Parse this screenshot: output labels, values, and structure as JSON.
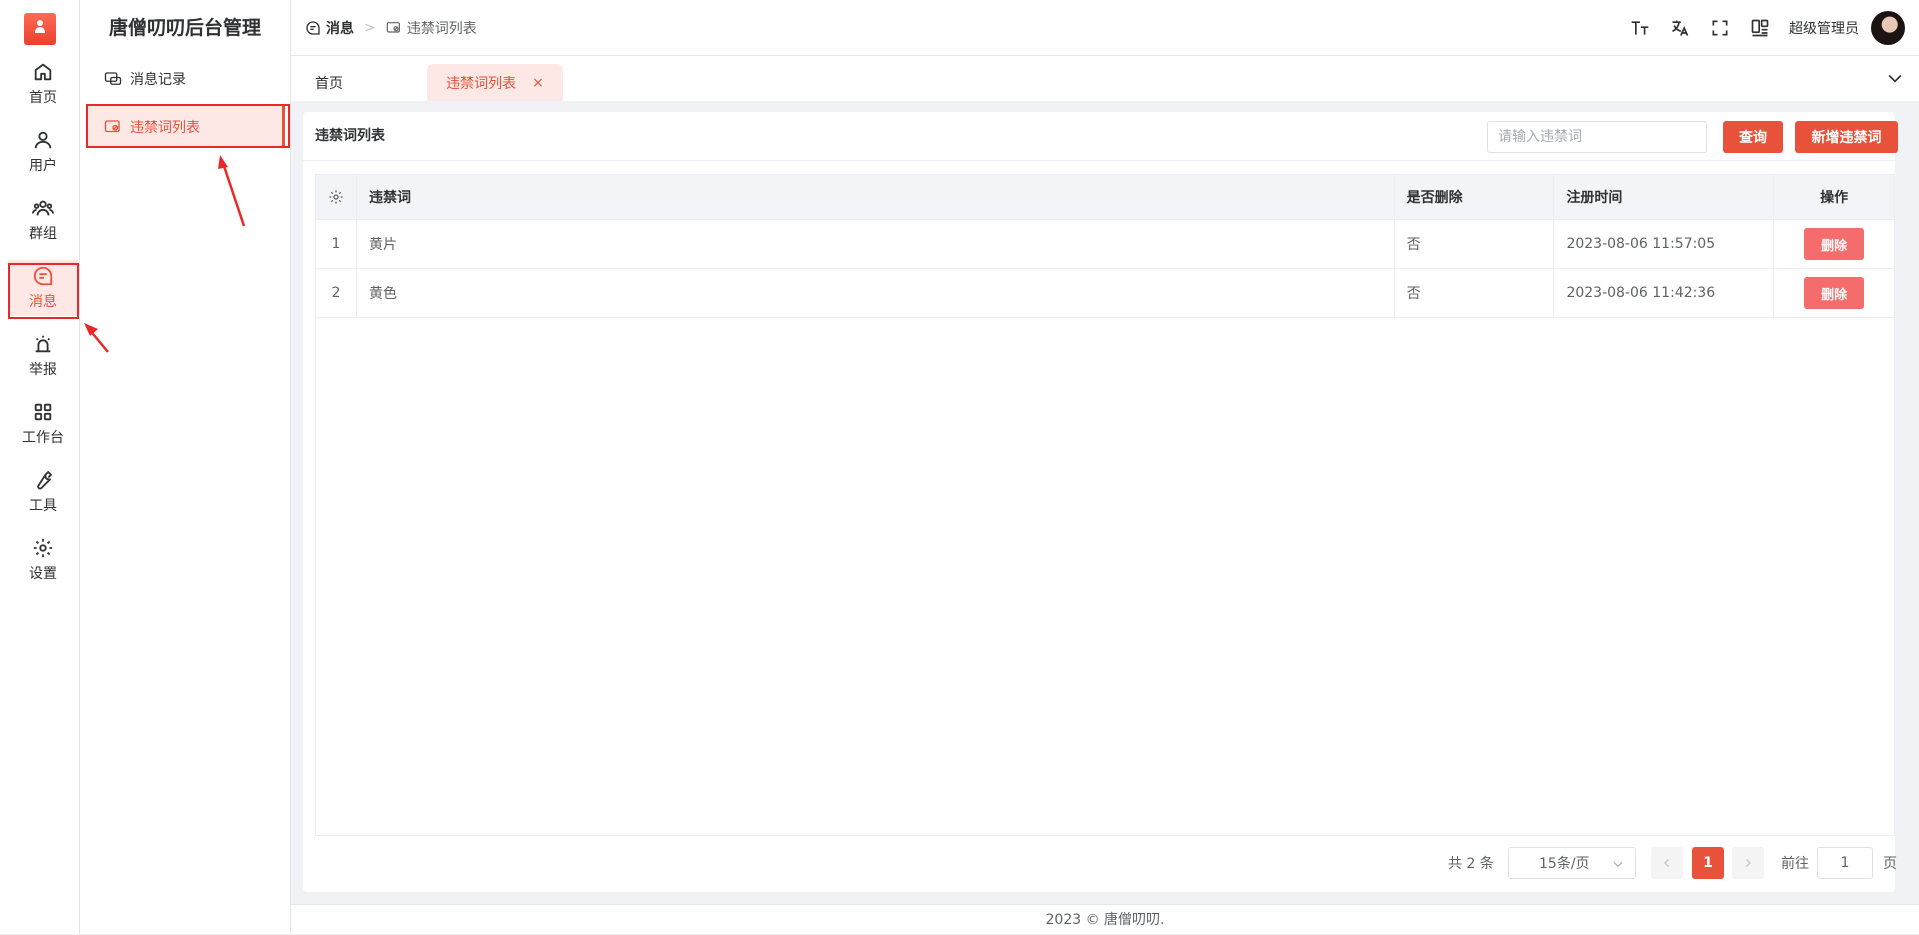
{
  "sidebar": {
    "items": [
      {
        "label": "首页",
        "icon": "home-icon"
      },
      {
        "label": "用户",
        "icon": "user-icon"
      },
      {
        "label": "群组",
        "icon": "group-icon"
      },
      {
        "label": "消息",
        "icon": "message-icon"
      },
      {
        "label": "举报",
        "icon": "alarm-icon"
      },
      {
        "label": "工作台",
        "icon": "grid-icon"
      },
      {
        "label": "工具",
        "icon": "wrench-icon"
      },
      {
        "label": "设置",
        "icon": "gear-icon"
      }
    ],
    "active_index": 3
  },
  "submenu": {
    "title": "唐僧叨叨后台管理",
    "items": [
      {
        "label": "消息记录",
        "icon": "chat-record-icon"
      },
      {
        "label": "违禁词列表",
        "icon": "forbidden-word-icon"
      }
    ],
    "active_index": 1
  },
  "header": {
    "breadcrumb": [
      "消息",
      "违禁词列表"
    ],
    "username": "超级管理员"
  },
  "tabs": {
    "home": "首页",
    "active": "违禁词列表",
    "close": "×"
  },
  "card": {
    "title": "违禁词列表",
    "search_placeholder": "请输入违禁词",
    "query_label": "查询",
    "add_label": "新增违禁词"
  },
  "table": {
    "columns": [
      "违禁词",
      "是否删除",
      "注册时间",
      "操作"
    ],
    "rows": [
      {
        "index": "1",
        "word": "黄片",
        "deleted": "否",
        "time": "2023-08-06 11:57:05",
        "action": "删除"
      },
      {
        "index": "2",
        "word": "黄色",
        "deleted": "否",
        "time": "2023-08-06 11:42:36",
        "action": "删除"
      }
    ]
  },
  "pagination": {
    "total": "共 2 条",
    "page_size": "15条/页",
    "current_page": "1",
    "goto_label": "前往",
    "goto_value": "1",
    "unit": "页"
  },
  "footer": {
    "text": "2023 © 唐僧叨叨."
  },
  "colors": {
    "accent": "#e8513a",
    "accent_light": "#fde8e6",
    "annotation": "#e8292b"
  }
}
